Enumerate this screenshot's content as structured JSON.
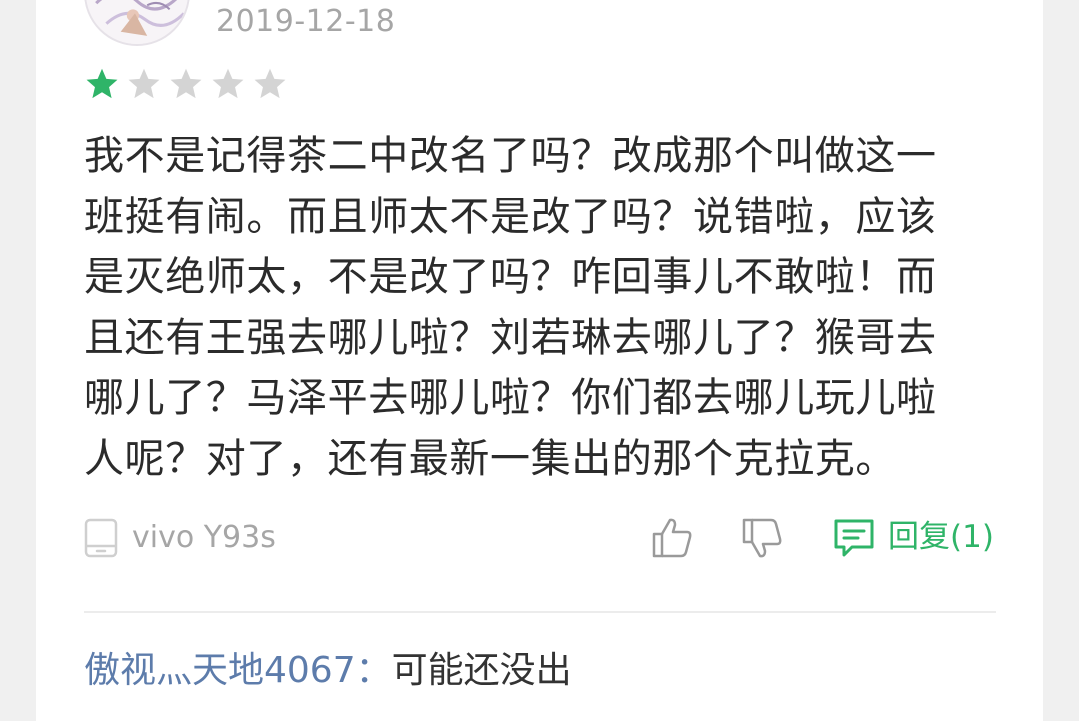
{
  "review": {
    "date": "2019-12-18",
    "rating": 1,
    "max_rating": 5,
    "text": "我不是记得茶二中改名了吗？改成那个叫做这一班挺有闹。而且师太不是改了吗？说错啦，应该是灭绝师太，不是改了吗？咋回事儿不敢啦！而且还有王强去哪儿啦？刘若琳去哪儿了？猴哥去哪儿了？马泽平去哪儿啦？你们都去哪儿玩儿啦人呢？对了，还有最新一集出的那个克拉克。",
    "device": "vivo Y93s",
    "reply_label": "回复(1)"
  },
  "first_reply": {
    "author": "傲视灬天地4067",
    "separator": "：",
    "text": "可能还没出"
  },
  "colors": {
    "star_filled": "#2fb468",
    "star_empty": "#d4d4d4",
    "reply_accent": "#2fb468",
    "author_link": "#5d7cab",
    "meta_text": "#a6a6a6"
  },
  "icons": {
    "like": "thumbs-up-icon",
    "dislike": "thumbs-down-icon",
    "reply": "comment-icon",
    "device": "phone-icon"
  }
}
